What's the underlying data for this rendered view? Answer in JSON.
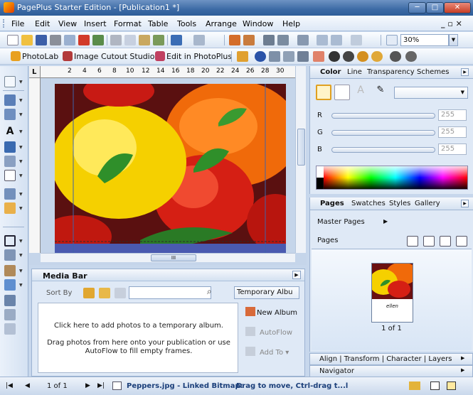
{
  "window": {
    "title": "PagePlus Starter Edition  - [Publication1 *]",
    "min_glyph": "─",
    "max_glyph": "□",
    "close_glyph": "✕"
  },
  "menu": {
    "items": [
      "File",
      "Edit",
      "View",
      "Insert",
      "Format",
      "Table",
      "Tools",
      "Arrange",
      "Window",
      "Help"
    ],
    "mdi_controls": "_ ▫ ✕"
  },
  "toolbar": {
    "zoom_value": "30%"
  },
  "photo_toolbar": {
    "photolab": "PhotoLab",
    "cutout": "Image Cutout Studio",
    "edit_in_photoplus": "Edit in PhotoPlus"
  },
  "ruler": {
    "top_numbers": [
      "2",
      "4",
      "6",
      "8",
      "10",
      "12",
      "14",
      "16",
      "18",
      "20",
      "22",
      "24",
      "26",
      "28",
      "30"
    ],
    "corner": "L"
  },
  "canvas": {
    "scroll_grip": "III"
  },
  "media_bar": {
    "title": "Media Bar",
    "sort_by": "Sort By",
    "search_placeholder": "",
    "album_select": "Temporary Albu",
    "drop_hint_1": "Click here to add photos to a temporary album.",
    "drop_hint_2a": "Drag photos from here onto your publication or use",
    "drop_hint_2b": "AutoFlow to fill empty frames.",
    "new_album": "New Album",
    "autoflow": "AutoFlow",
    "add_to": "Add To"
  },
  "color_panel": {
    "tabs": [
      "Color",
      "Line",
      "Transparency",
      "Schemes"
    ],
    "r_label": "R",
    "g_label": "G",
    "b_label": "B",
    "r_value": "255",
    "g_value": "255",
    "b_value": "255"
  },
  "pages_panel": {
    "tabs": [
      "Pages",
      "Swatches",
      "Styles",
      "Gallery"
    ],
    "master_pages": "Master Pages",
    "pages": "Pages",
    "page_count": "1 of 1",
    "thumb_caption": "ellen"
  },
  "collapsed_panels": {
    "align": "Align | Transform | Character | Layers",
    "navigator": "Navigator"
  },
  "status": {
    "page": "1 of 1",
    "filename": "Peppers.jpg - Linked Bitmap:",
    "hint": "Drag to move, Ctrl-drag t...l"
  },
  "colors": {
    "accent": "#2e5d98",
    "panel_bg": "#dfe9f6",
    "pepper_yellow": "#f5d000",
    "pepper_red": "#d51f14",
    "pepper_orange": "#f06a0a",
    "stem_green": "#2f8f2a"
  }
}
